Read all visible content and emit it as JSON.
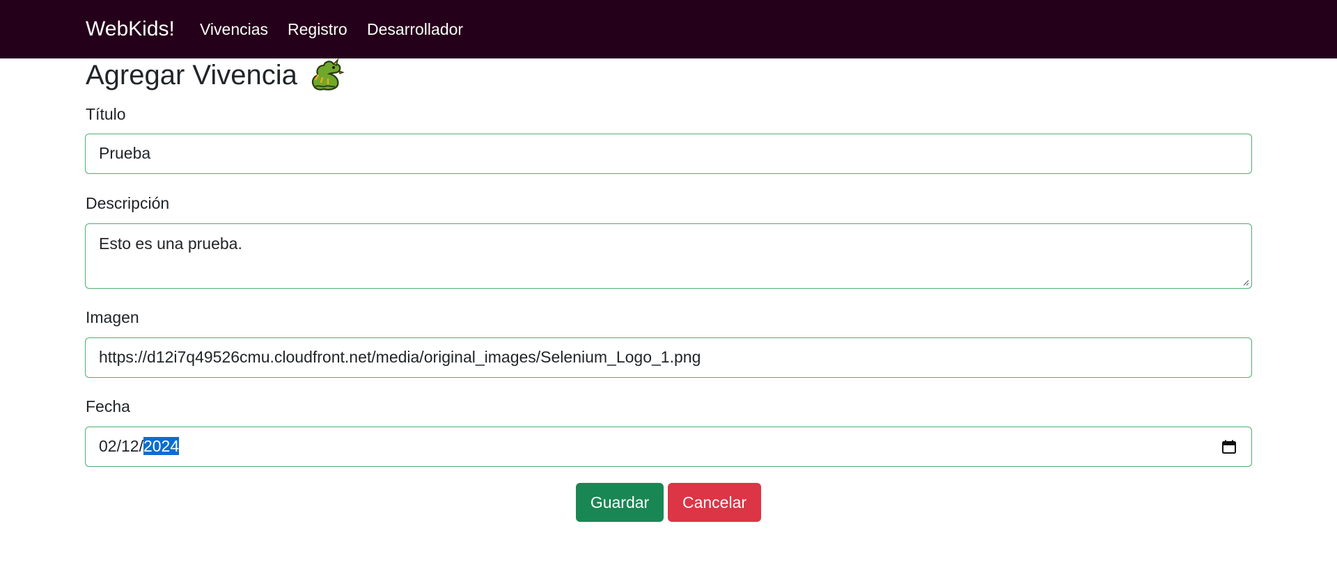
{
  "navbar": {
    "brand": "WebKids!",
    "links": [
      "Vivencias",
      "Registro",
      "Desarrollador"
    ]
  },
  "page": {
    "title": "Agregar Vivencia",
    "title_icon": "dragon-icon"
  },
  "form": {
    "titulo": {
      "label": "Título",
      "value": "Prueba"
    },
    "descripcion": {
      "label": "Descripción",
      "value": "Esto es una prueba."
    },
    "imagen": {
      "label": "Imagen",
      "value": "https://d12i7q49526cmu.cloudfront.net/media/original_images/Selenium_Logo_1.png"
    },
    "fecha": {
      "label": "Fecha",
      "month": "02",
      "day": "12",
      "year": "2024",
      "separator": "/",
      "selected_segment": "year",
      "icon": "calendar-icon"
    },
    "buttons": {
      "save_label": "Guardar",
      "cancel_label": "Cancelar"
    }
  },
  "colors": {
    "navbar_bg": "#25001a",
    "field_border": "#4caf70",
    "save_button": "#198754",
    "cancel_button": "#dc3545",
    "selection": "#0a6ed1"
  }
}
